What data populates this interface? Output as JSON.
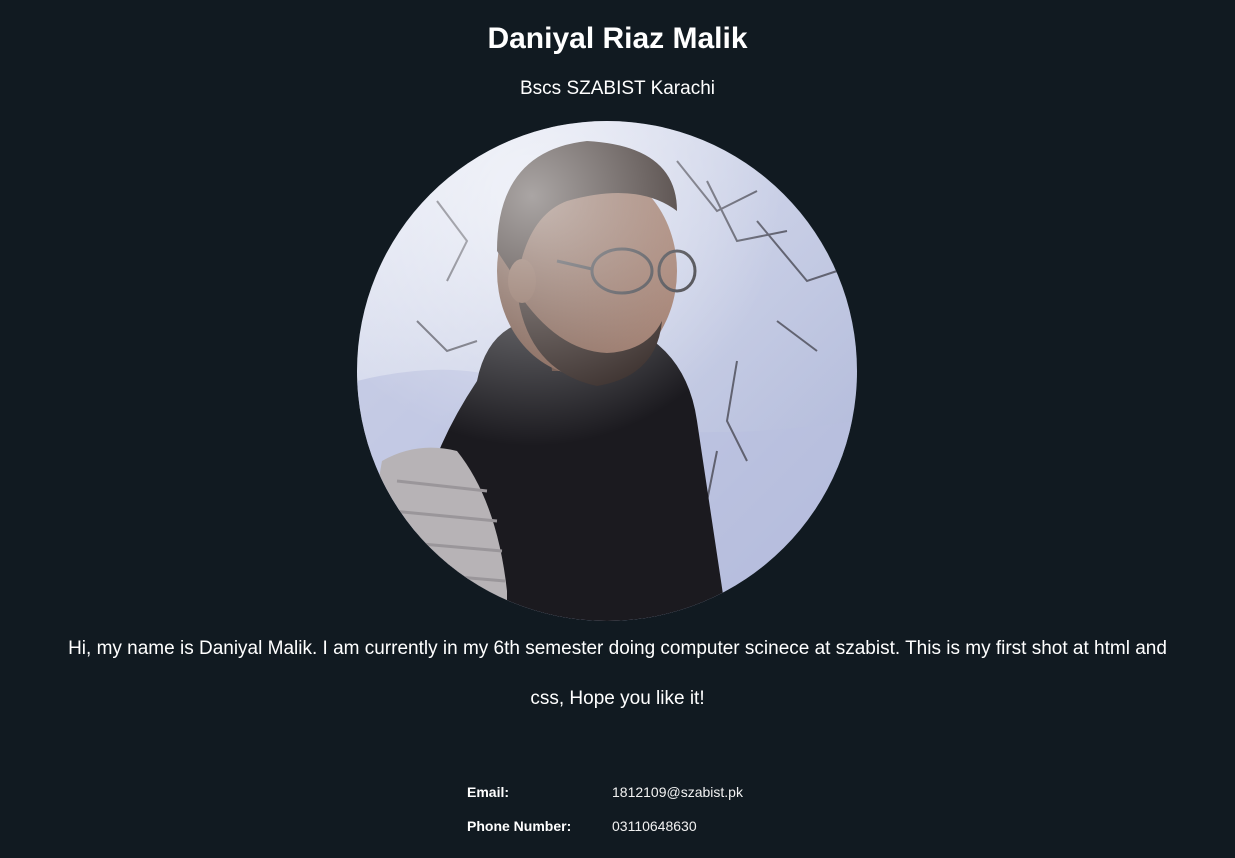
{
  "profile": {
    "name": "Daniyal Riaz Malik",
    "subtitle": "Bscs SZABIST Karachi",
    "bio": "Hi, my name is Daniyal Malik. I am currently in my 6th semester doing computer scinece at szabist. This is my first shot at html and css, Hope you like it!"
  },
  "contact": {
    "email_label": "Email:",
    "email_value": "1812109@szabist.pk",
    "phone_label": "Phone Number:",
    "phone_value": "03110648630"
  },
  "colors": {
    "background": "#111a21",
    "text": "#ffffff"
  }
}
